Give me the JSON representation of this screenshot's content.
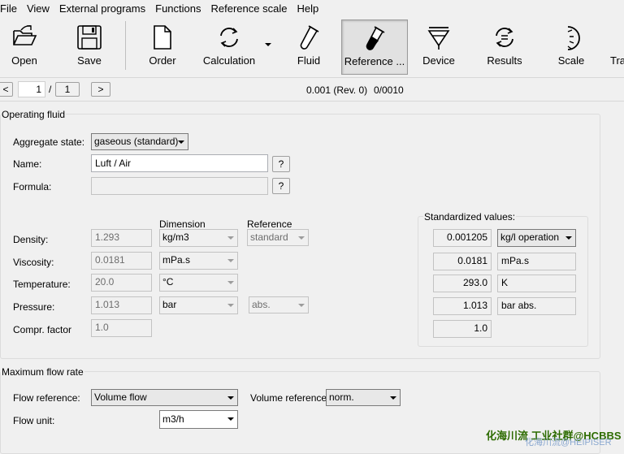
{
  "menu": [
    "File",
    "View",
    "External programs",
    "Functions",
    "Reference scale",
    "Help"
  ],
  "toolbar": {
    "open": "Open",
    "save": "Save",
    "order": "Order",
    "calculation": "Calculation",
    "fluid": "Fluid",
    "reference": "Reference ...",
    "device": "Device",
    "results": "Results",
    "scale": "Scale",
    "tra": "Tra"
  },
  "nav": {
    "prev": "<",
    "page": "1",
    "slash": "/",
    "total": "1",
    "next": ">",
    "revision": "0.001 (Rev. 0)",
    "counter": "0/0010"
  },
  "operating_fluid": {
    "title": "Operating fluid",
    "aggregate_label": "Aggregate state:",
    "aggregate_value": "gaseous (standard)",
    "name_label": "Name:",
    "name_value": "Luft / Air",
    "help": "?",
    "formula_label": "Formula:",
    "formula_value": "",
    "dimension_header": "Dimension",
    "reference_header": "Reference",
    "density_label": "Density:",
    "density_value": "1.293",
    "density_unit": "kg/m3",
    "density_ref": "standard",
    "viscosity_label": "Viscosity:",
    "viscosity_value": "0.0181",
    "viscosity_unit": "mPa.s",
    "temperature_label": "Temperature:",
    "temperature_value": "20.0",
    "temperature_unit": "°C",
    "pressure_label": "Pressure:",
    "pressure_value": "1.013",
    "pressure_unit": "bar",
    "pressure_ref": "abs.",
    "compr_label": "Compr. factor",
    "compr_value": "1.0"
  },
  "standardized": {
    "title": "Standardized values:",
    "density_value": "0.001205",
    "density_unit": "kg/l operation",
    "viscosity_value": "0.0181",
    "viscosity_unit": "mPa.s",
    "temperature_value": "293.0",
    "temperature_unit": "K",
    "pressure_value": "1.013",
    "pressure_unit": "bar abs.",
    "compr_value": "1.0"
  },
  "max_flow": {
    "title": "Maximum flow rate",
    "flow_ref_label": "Flow reference:",
    "flow_ref_value": "Volume flow",
    "volume_ref_label": "Volume reference:",
    "volume_ref_value": "norm.",
    "flow_unit_label": "Flow unit:",
    "flow_unit_value": "m3/h"
  },
  "watermark": {
    "line1": "化海川流 工业社群@HCBBS",
    "line2": "化海川流@HEIPISER"
  },
  "colors": {
    "background": "#f0f0f0",
    "field_border": "#abadb3",
    "watermark": "#2d6b00"
  }
}
